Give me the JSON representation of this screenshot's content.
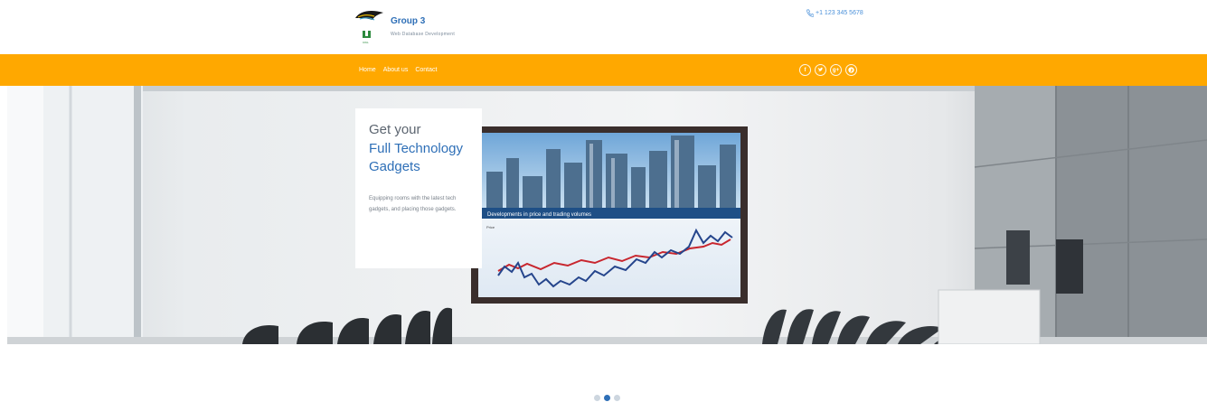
{
  "header": {
    "brand_title": "Group 3",
    "brand_subtitle": "Web Database Development",
    "logo_label": "UIKL",
    "phone": "+1 123 345 5678"
  },
  "nav": {
    "links": [
      "Home",
      "About us",
      "Contact"
    ]
  },
  "social": [
    "f",
    "t",
    "g+",
    "p"
  ],
  "hero": {
    "heading_line1": "Get your",
    "heading_line2": "Full Technology",
    "heading_line3": "Gadgets",
    "body": "Equipping rooms with the latest tech gadgets, and placing those gadgets.",
    "screen_caption": "Developments in price and trading volumes",
    "screen_axis": "Price"
  },
  "carousel": {
    "slides": 3,
    "active_index": 1
  },
  "colors": {
    "accent": "#ffa800",
    "brand_blue": "#2e6fb7",
    "dot_inactive": "#cdd6df"
  }
}
